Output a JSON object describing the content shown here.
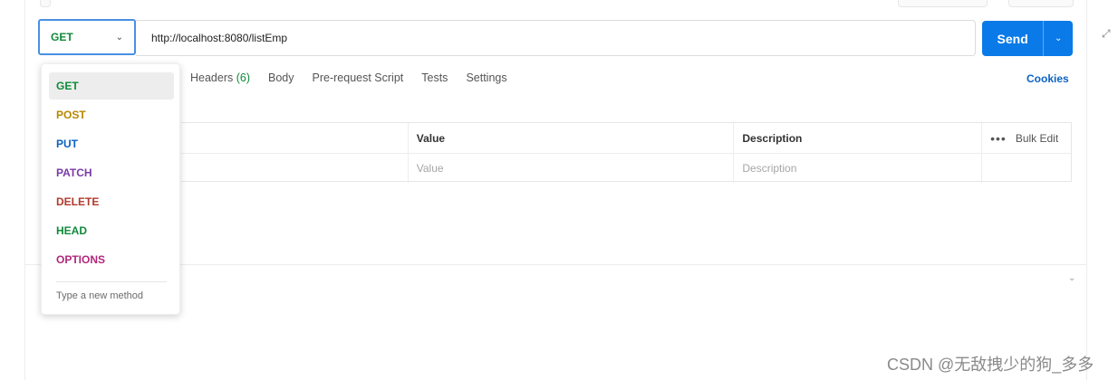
{
  "request": {
    "method": "GET",
    "url": "http://localhost:8080/listEmp",
    "send_label": "Send"
  },
  "tabs": {
    "headers_label": "Headers",
    "headers_count": "(6)",
    "body_label": "Body",
    "prerequest_label": "Pre-request Script",
    "tests_label": "Tests",
    "settings_label": "Settings",
    "cookies_label": "Cookies"
  },
  "params_table": {
    "columns": {
      "value": "Value",
      "description": "Description",
      "bulk_edit": "Bulk Edit"
    },
    "placeholders": {
      "value": "Value",
      "description": "Description"
    }
  },
  "method_dropdown": {
    "options": [
      {
        "label": "GET",
        "color": "#0f8a3a"
      },
      {
        "label": "POST",
        "color": "#b58900"
      },
      {
        "label": "PUT",
        "color": "#0b62c4"
      },
      {
        "label": "PATCH",
        "color": "#7a3aa6"
      },
      {
        "label": "DELETE",
        "color": "#b03a2e"
      },
      {
        "label": "HEAD",
        "color": "#0f8a3a"
      },
      {
        "label": "OPTIONS",
        "color": "#b0287a"
      }
    ],
    "new_method_placeholder": "Type a new method"
  },
  "watermark": "CSDN @无敌拽少的狗_多多",
  "icons": [
    "chevron-down-icon",
    "more-dots-icon",
    "expand-icon"
  ]
}
